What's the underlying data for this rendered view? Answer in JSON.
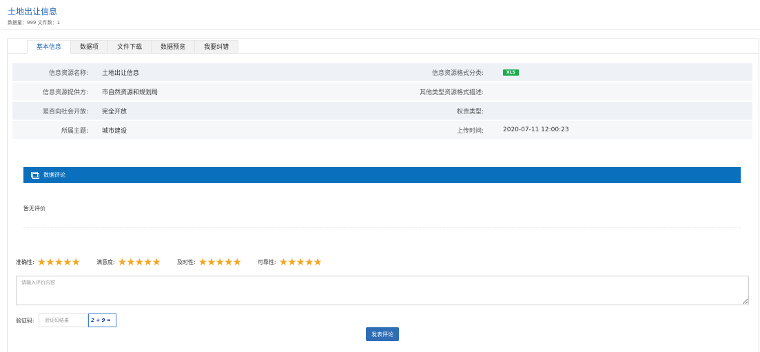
{
  "header": {
    "title": "土地出让信息",
    "subtitle": "数据量：999 文件数：1"
  },
  "tabs": [
    {
      "label": "基本信息",
      "active": true
    },
    {
      "label": "数据项",
      "active": false
    },
    {
      "label": "文件下载",
      "active": false
    },
    {
      "label": "数据预览",
      "active": false
    },
    {
      "label": "我要纠错",
      "active": false
    }
  ],
  "info": {
    "resource_name_label": "信息资源名称:",
    "resource_name": "土地出让信息",
    "format_label": "信息资源格式分类:",
    "format_badge": "XLS",
    "provider_label": "信息资源提供方:",
    "provider": "市自然资源和规划局",
    "other_format_label": "其他类型资源格式描述:",
    "other_format": "",
    "open_label": "是否向社会开放:",
    "open": "完全开放",
    "rights_label": "权责类型:",
    "rights": "",
    "topic_label": "所属主题:",
    "topic": "城市建设",
    "upload_label": "上传时间:",
    "upload_time": "2020-07-11 12:00:23"
  },
  "comments": {
    "section_title": "数据评论",
    "empty_text": "暂无评价"
  },
  "ratings": [
    {
      "label": "准确性:",
      "stars": 5
    },
    {
      "label": "满意度:",
      "stars": 5
    },
    {
      "label": "及时性:",
      "stars": 5
    },
    {
      "label": "可靠性:",
      "stars": 5
    }
  ],
  "review": {
    "placeholder": "请输入评价内容",
    "value": ""
  },
  "captcha": {
    "label": "验证码:",
    "placeholder": "验证码结果",
    "challenge": "2 + 9 ="
  },
  "submit_label": "发表评论",
  "colors": {
    "accent": "#0a6fbd",
    "title": "#1e64b4",
    "star": "#f5a623",
    "badge": "#1aab4c"
  }
}
